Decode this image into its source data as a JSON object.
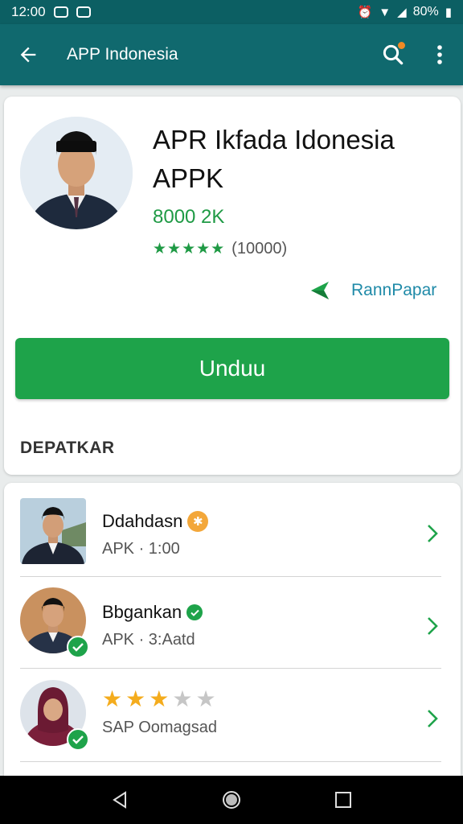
{
  "status_bar": {
    "time": "12:00",
    "battery": "80%"
  },
  "app_bar": {
    "title": "APP Indonesia"
  },
  "app": {
    "title_line1": "APR Ikfada Idonesia",
    "title_line2": "APPK",
    "size": "8000 2K",
    "stars": "★★★★★",
    "reviews": "(10000)",
    "publisher": "RannPapar",
    "download_label": "Unduu"
  },
  "section": {
    "label": "DEPATKAR"
  },
  "list": [
    {
      "name": "Ddahdasn",
      "sub": "APK · 1:00"
    },
    {
      "name": "Bbgankan",
      "sub": "APK · 3:Aatd"
    },
    {
      "rating": 3,
      "max_rating": 5,
      "sub": "SAP Oomagsad"
    }
  ],
  "colors": {
    "app_bar": "#10696e",
    "status_bar": "#0c5f63",
    "accent_green": "#1ea34a",
    "star_gold": "#f4ac1d"
  }
}
